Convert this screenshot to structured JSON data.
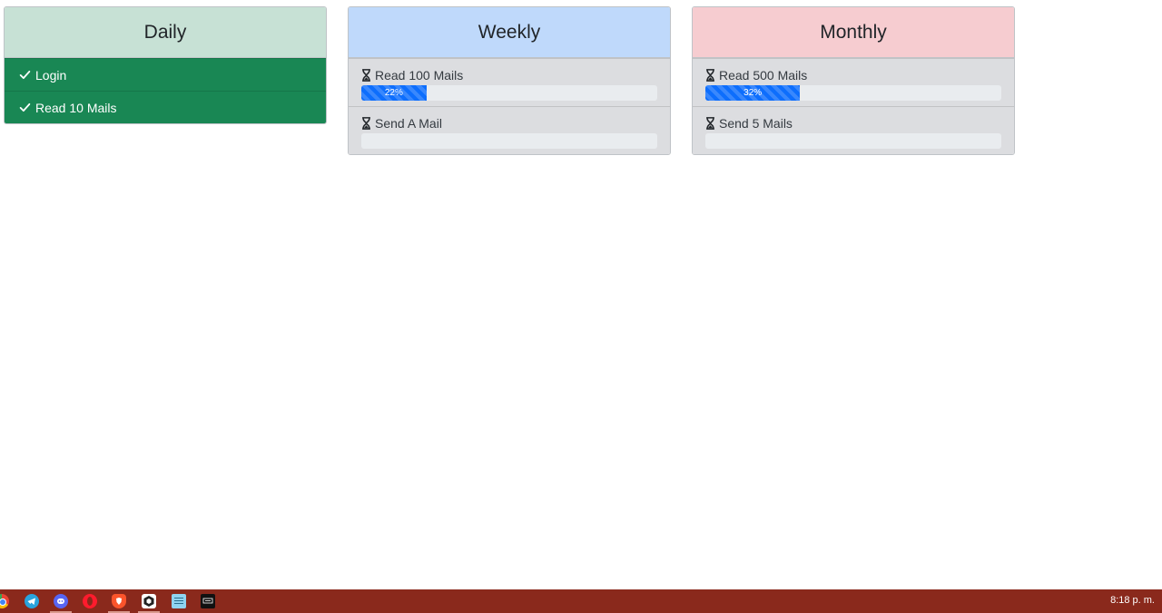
{
  "columns": {
    "daily": {
      "title": "Daily",
      "header_color": "#c7e1d5",
      "tasks": [
        {
          "label": "Login",
          "status": "completed"
        },
        {
          "label": "Read 10 Mails",
          "status": "completed"
        }
      ]
    },
    "weekly": {
      "title": "Weekly",
      "header_color": "#bfd9fb",
      "tasks": [
        {
          "label": "Read 100 Mails",
          "status": "pending",
          "progress": 22,
          "progress_label": "22%"
        },
        {
          "label": "Send A Mail",
          "status": "pending",
          "progress": 0,
          "progress_label": ""
        }
      ]
    },
    "monthly": {
      "title": "Monthly",
      "header_color": "#f6ccd0",
      "tasks": [
        {
          "label": "Read 500 Mails",
          "status": "pending",
          "progress": 32,
          "progress_label": "32%"
        },
        {
          "label": "Send 5 Mails",
          "status": "pending",
          "progress": 0,
          "progress_label": ""
        }
      ]
    }
  },
  "colors": {
    "completed": "#198754",
    "progress": "#0d6efd",
    "taskbar": "#8a291c"
  },
  "taskbar": {
    "apps": [
      "chrome-icon",
      "telegram-icon",
      "discord-icon",
      "opera-icon",
      "brave-icon",
      "unity-hub-icon",
      "notepad-icon",
      "epic-games-icon"
    ],
    "clock": "8:18 p. m."
  }
}
